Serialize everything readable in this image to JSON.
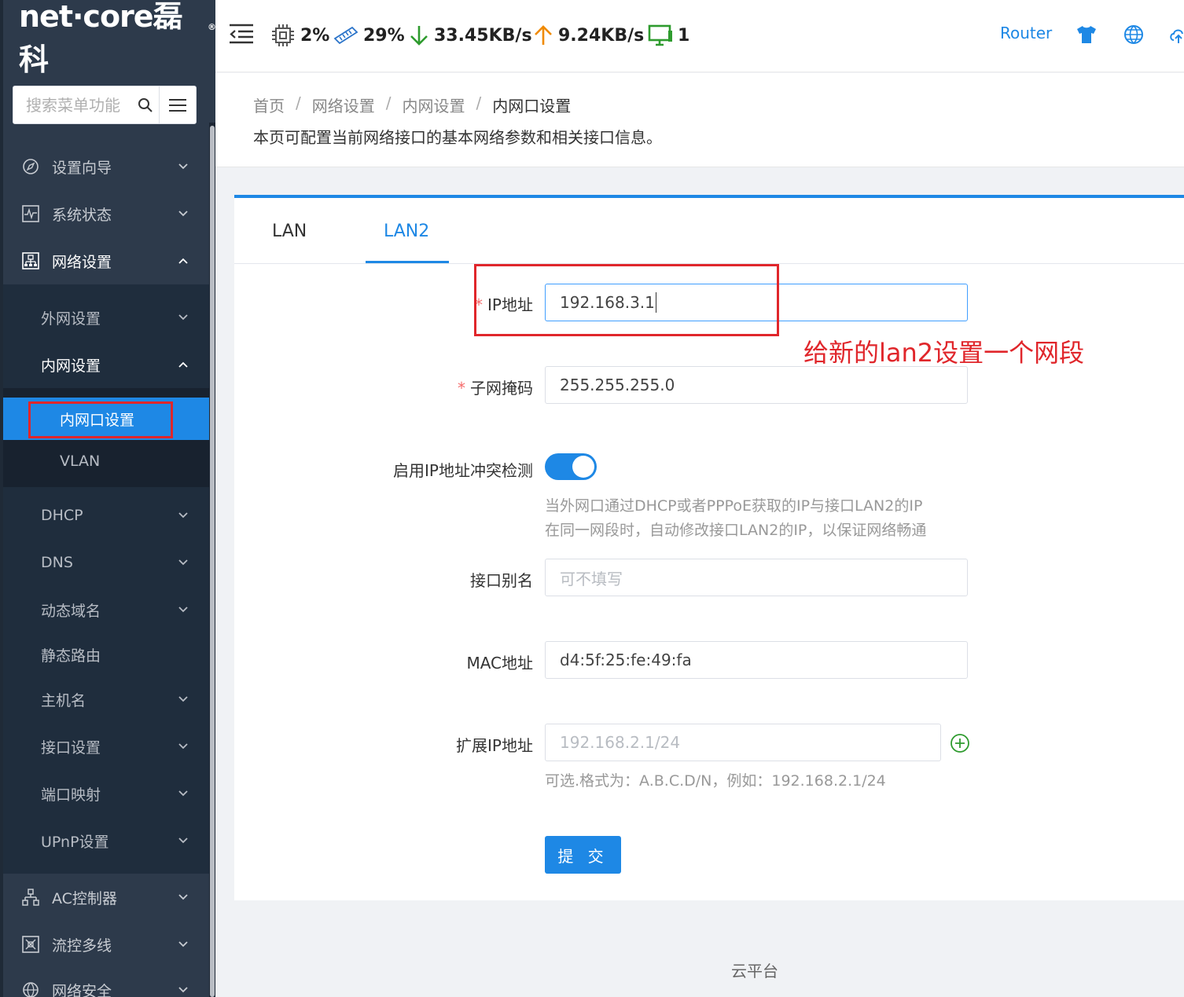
{
  "brand": {
    "logo_text": "net·core磊科",
    "reg_mark": "®"
  },
  "search": {
    "placeholder": "搜索菜单功能"
  },
  "sidebar": {
    "items": [
      {
        "label": "设置向导",
        "icon": "compass-icon"
      },
      {
        "label": "系统状态",
        "icon": "pulse-icon"
      },
      {
        "label": "网络设置",
        "icon": "network-icon"
      },
      {
        "label": "AC控制器",
        "icon": "sitemap-icon"
      },
      {
        "label": "流控多线",
        "icon": "flow-icon"
      },
      {
        "label": "网络安全",
        "icon": "shield-icon"
      }
    ],
    "network_sub": [
      {
        "label": "外网设置"
      },
      {
        "label": "内网设置"
      },
      {
        "label": "DHCP"
      },
      {
        "label": "DNS"
      },
      {
        "label": "动态域名"
      },
      {
        "label": "静态路由"
      },
      {
        "label": "主机名"
      },
      {
        "label": "接口设置"
      },
      {
        "label": "端口映射"
      },
      {
        "label": "UPnP设置"
      }
    ],
    "lan_sub": [
      {
        "label": "内网口设置"
      },
      {
        "label": "VLAN"
      }
    ]
  },
  "topbar": {
    "cpu": "2%",
    "memory": "29%",
    "download": "33.45KB/s",
    "upload": "9.24KB/s",
    "clients": "1",
    "router_label": "Router",
    "colors": {
      "accent": "#1e88e5",
      "download": "#2e9b2e",
      "upload": "#f08a00",
      "clients": "#2e9b2e"
    }
  },
  "breadcrumb": {
    "items": [
      "首页",
      "网络设置",
      "内网设置",
      "内网口设置"
    ],
    "sep": "/"
  },
  "page_desc": "本页可配置当前网络接口的基本网络参数和相关接口信息。",
  "tabs": [
    {
      "label": "LAN"
    },
    {
      "label": "LAN2"
    }
  ],
  "form": {
    "ip_label": "IP地址",
    "ip_value": "192.168.3.1",
    "mask_label": "子网掩码",
    "mask_value": "255.255.255.0",
    "conflict_label": "启用IP地址冲突检测",
    "conflict_enabled": true,
    "conflict_hint_1": "当外网口通过DHCP或者PPPoE获取的IP与接口LAN2的IP",
    "conflict_hint_2": "在同一网段时，自动修改接口LAN2的IP，以保证网络畅通",
    "alias_label": "接口别名",
    "alias_placeholder": "可不填写",
    "mac_label": "MAC地址",
    "mac_value": "d4:5f:25:fe:49:fa",
    "ext_label": "扩展IP地址",
    "ext_placeholder": "192.168.2.1/24",
    "ext_hint": "可选.格式为：A.B.C.D/N，例如：192.168.2.1/24",
    "required_mark": "*",
    "submit_label": "提 交"
  },
  "annotation": "给新的lan2设置一个网段",
  "footer": "云平台"
}
